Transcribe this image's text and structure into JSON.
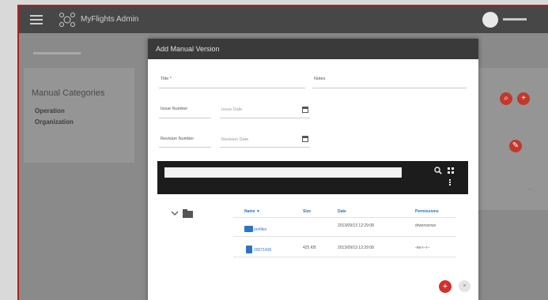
{
  "app": {
    "brand": "MyFlights Admin"
  },
  "background": {
    "categories_title": "Manual Categories",
    "categories": [
      "Operation",
      "Organization"
    ]
  },
  "modal": {
    "title": "Add Manual Version",
    "fields": {
      "title_label": "Title *",
      "notes_label": "Notes",
      "issue_label": "Issue Number",
      "issue_placeholder": "Issue Date",
      "revision_label": "Revision Number",
      "revision_placeholder": "Revision Date"
    },
    "file_manager": {
      "columns": [
        "Name ▼",
        "Size",
        "Date",
        "Permissions"
      ],
      "rows": [
        {
          "name": "profiles",
          "size": "",
          "date": "2013/09/13 12:29:08",
          "permissions": "drwxrwxrwx"
        },
        {
          "name": "20071435",
          "size": "425 KB",
          "date": "2013/09/13 12:29:08",
          "permissions": "-rw-r--r--"
        }
      ]
    },
    "buttons": {
      "add": "+",
      "cancel": "×"
    }
  },
  "colors": {
    "accent": "#c0392b",
    "header": "#3a3a3a",
    "link": "#2d75c4"
  }
}
